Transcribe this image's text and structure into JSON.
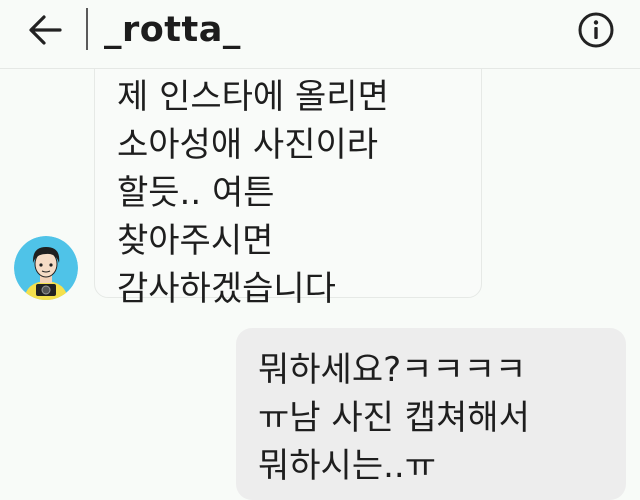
{
  "header": {
    "username": "_rotta_"
  },
  "conversation": {
    "incoming": {
      "text": "제 인스타에 올리면\n소아성애 사진이라\n할듯..  여튼\n찾아주시면\n감사하겠습니다"
    },
    "outgoing": {
      "text": "뭐하세요?ㅋㅋㅋㅋ\nㅠ남 사진 캡쳐해서\n뭐하시는..ㅠ"
    }
  }
}
